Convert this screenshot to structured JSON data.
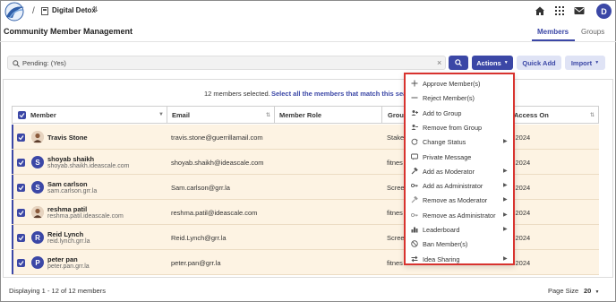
{
  "header": {
    "space_name": "Digital Detox",
    "avatar_initial": "D"
  },
  "page": {
    "title": "Community Member Management",
    "tabs": [
      {
        "label": "Members",
        "active": true
      },
      {
        "label": "Groups",
        "active": false
      }
    ]
  },
  "filter": {
    "text": "Pending: (Yes)"
  },
  "toolbar": {
    "actions_label": "Actions",
    "quick_add_label": "Quick Add",
    "import_label": "Import"
  },
  "selection": {
    "count_text": "12 members selected.",
    "select_all_text": "Select all the members that match this search"
  },
  "table": {
    "headers": {
      "member": "Member",
      "email": "Email",
      "role": "Member Role",
      "group": "Group",
      "access": "Access On"
    },
    "rows": [
      {
        "name": "Travis Stone",
        "username": "",
        "email": "travis.stone@guerrillamail.com",
        "group": "Stake",
        "access": "-2024",
        "avatar": "photo",
        "initial": ""
      },
      {
        "name": "shoyab shaikh",
        "username": "shoyab.shaikh.ideascale.com",
        "email": "shoyab.shaikh@ideascale.com",
        "group": "fitnes",
        "access": "-2024",
        "avatar": "initial",
        "initial": "S"
      },
      {
        "name": "Sam carlson",
        "username": "sam.carlson.grr.la",
        "email": "Sam.carlson@grr.la",
        "group": "Scree",
        "access": "-2024",
        "avatar": "initial",
        "initial": "S"
      },
      {
        "name": "reshma patil",
        "username": "reshma.patil.ideascale.com",
        "email": "reshma.patil@ideascale.com",
        "group": "fitnes",
        "access": "-2024",
        "avatar": "photo",
        "initial": ""
      },
      {
        "name": "Reid Lynch",
        "username": "reid.lynch.grr.la",
        "email": "Reid.Lynch@grr.la",
        "group": "Scree",
        "access": "-2024",
        "avatar": "initial",
        "initial": "R"
      },
      {
        "name": "peter pan",
        "username": "peter.pan.grr.la",
        "email": "peter.pan@grr.la",
        "group": "fitnes",
        "access": "-2024",
        "avatar": "initial",
        "initial": "P"
      }
    ]
  },
  "footer": {
    "displaying": "Displaying 1 - 12 of 12 members",
    "page_size_label": "Page Size",
    "page_size_value": "20"
  },
  "actions_menu": {
    "items": [
      {
        "label": "Approve Member(s)",
        "icon": "plus-icon",
        "submenu": false
      },
      {
        "label": "Reject Member(s)",
        "icon": "minus-icon",
        "submenu": false
      },
      {
        "label": "Add to Group",
        "icon": "group-add-icon",
        "submenu": false
      },
      {
        "label": "Remove from Group",
        "icon": "group-remove-icon",
        "submenu": false
      },
      {
        "label": "Change Status",
        "icon": "refresh-icon",
        "submenu": true
      },
      {
        "label": "Private Message",
        "icon": "message-icon",
        "submenu": false
      },
      {
        "label": "Add as Moderator",
        "icon": "hammer-icon",
        "submenu": true
      },
      {
        "label": "Add as Administrator",
        "icon": "key-icon",
        "submenu": true
      },
      {
        "label": "Remove as Moderator",
        "icon": "hammer-off-icon",
        "submenu": true
      },
      {
        "label": "Remove as Administrator",
        "icon": "key-off-icon",
        "submenu": true
      },
      {
        "label": "Leaderboard",
        "icon": "chart-icon",
        "submenu": true
      },
      {
        "label": "Ban Member(s)",
        "icon": "ban-icon",
        "submenu": false
      },
      {
        "label": "Idea Sharing",
        "icon": "share-icon",
        "submenu": true
      }
    ]
  }
}
